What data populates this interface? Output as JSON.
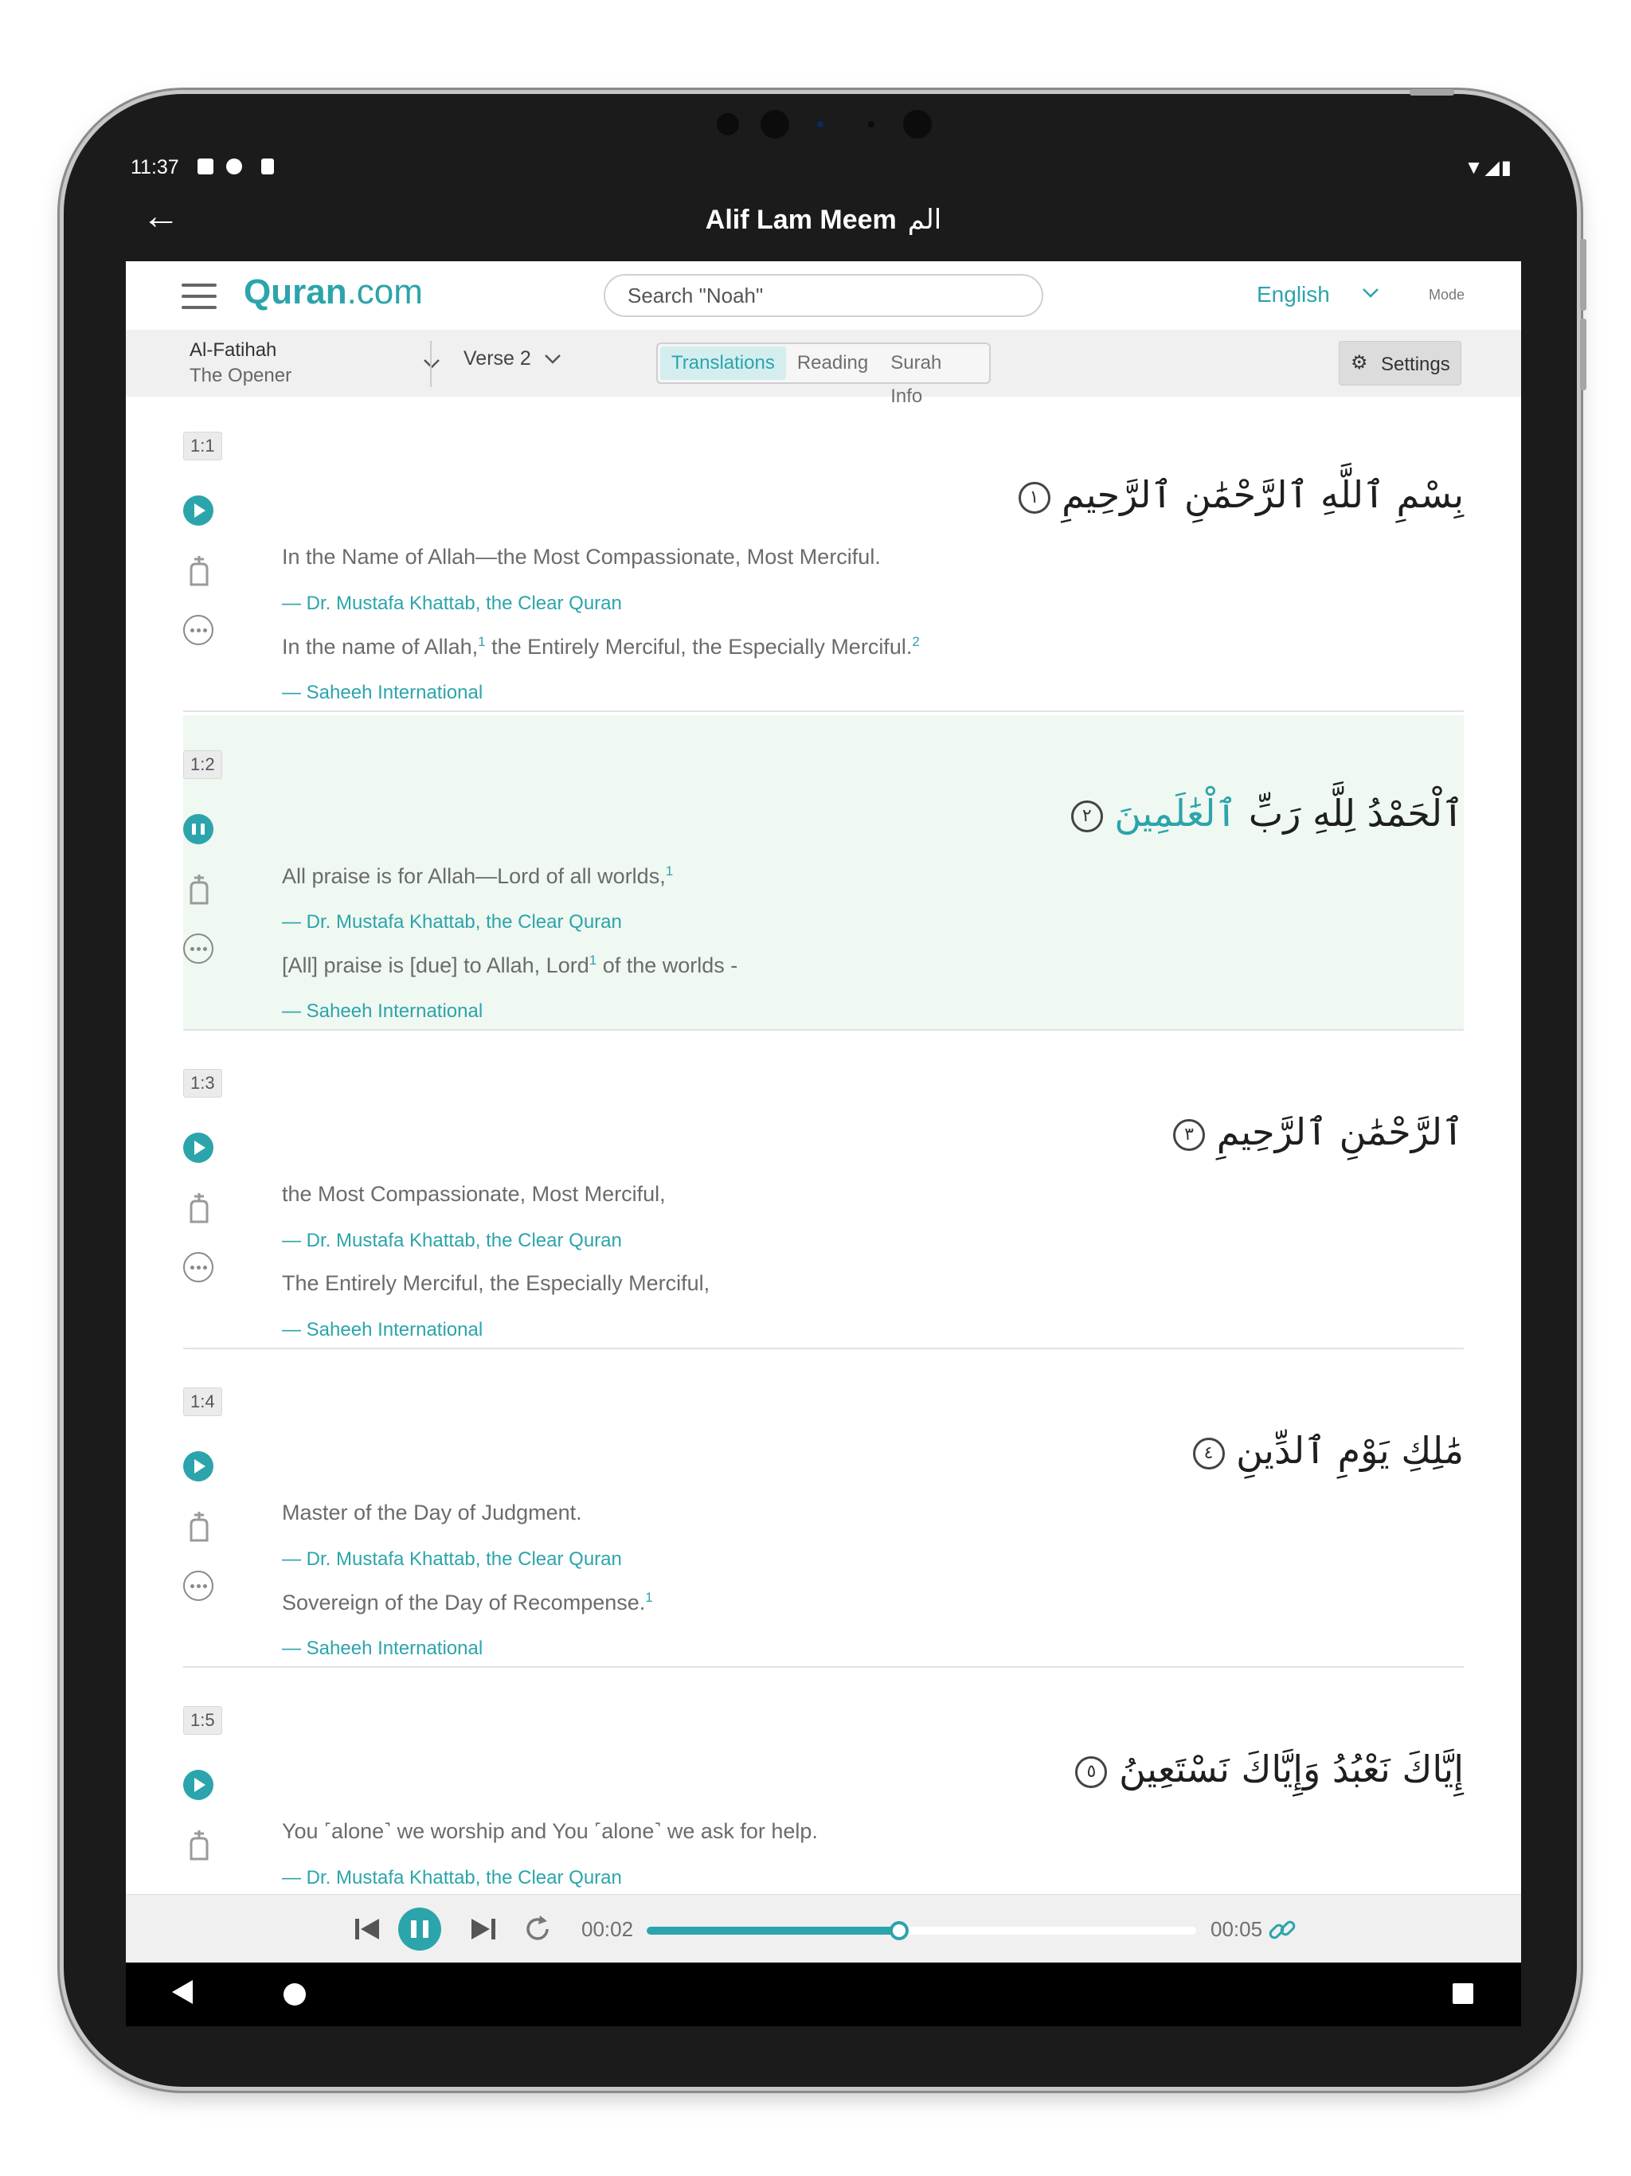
{
  "status_bar": {
    "time": "11:37",
    "left_icons": [
      "a-notification-icon",
      "circle-half-icon",
      "sd-card-icon"
    ],
    "right_icons": [
      "wifi-icon",
      "signal-icon",
      "battery-icon"
    ]
  },
  "app_bar": {
    "title": "Alif Lam Meem",
    "title_arabic": "الم"
  },
  "nav": {
    "logo_bold": "Quran",
    "logo_rest": ".com",
    "search_placeholder": "Search \"Noah\"",
    "language": "English",
    "mode_label": "Mode"
  },
  "toolbar": {
    "surah_name": "Al-Fatihah",
    "surah_translation": "The Opener",
    "verse_label": "Verse 2",
    "tabs": [
      "Translations",
      "Reading",
      "Surah Info"
    ],
    "active_tab": "Translations",
    "settings_label": "Settings"
  },
  "verses": [
    {
      "key": "1:1",
      "arabic": "بِسْمِ ٱللَّهِ ٱلرَّحْمَٰنِ ٱلرَّحِيمِ",
      "arabic_highlight": "",
      "end_marker": "١",
      "playing": false,
      "translations": [
        {
          "text": "In the Name of Allah—the Most Compassionate, Most Merciful.",
          "source": "— Dr. Mustafa Khattab, the Clear Quran"
        },
        {
          "text": "In the name of Allah,¹ the Entirely Merciful, the Especially Merciful.²",
          "source": "— Saheeh International"
        }
      ]
    },
    {
      "key": "1:2",
      "arabic": "ٱلْحَمْدُ لِلَّهِ رَبِّ",
      "arabic_highlight": "ٱلْعَٰلَمِينَ",
      "end_marker": "٢",
      "playing": true,
      "translations": [
        {
          "text": "All praise is for Allah—Lord of all worlds,¹",
          "source": "— Dr. Mustafa Khattab, the Clear Quran"
        },
        {
          "text": "[All] praise is [due] to Allah, Lord¹ of the worlds -",
          "source": "— Saheeh International"
        }
      ]
    },
    {
      "key": "1:3",
      "arabic": "ٱلرَّحْمَٰنِ ٱلرَّحِيمِ",
      "arabic_highlight": "",
      "end_marker": "٣",
      "playing": false,
      "translations": [
        {
          "text": "the Most Compassionate, Most Merciful,",
          "source": "— Dr. Mustafa Khattab, the Clear Quran"
        },
        {
          "text": "The Entirely Merciful, the Especially Merciful,",
          "source": "— Saheeh International"
        }
      ]
    },
    {
      "key": "1:4",
      "arabic": "مَٰلِكِ يَوْمِ ٱلدِّينِ",
      "arabic_highlight": "",
      "end_marker": "٤",
      "playing": false,
      "translations": [
        {
          "text": "Master of the Day of Judgment.",
          "source": "— Dr. Mustafa Khattab, the Clear Quran"
        },
        {
          "text": "Sovereign of the Day of Recompense.¹",
          "source": "— Saheeh International"
        }
      ]
    },
    {
      "key": "1:5",
      "arabic": "إِيَّاكَ نَعْبُدُ وَإِيَّاكَ نَسْتَعِينُ",
      "arabic_highlight": "",
      "end_marker": "٥",
      "playing": false,
      "translations": [
        {
          "text": "You ˹alone˺ we worship and You ˹alone˺ we ask for help.",
          "source": "— Dr. Mustafa Khattab, the Clear Quran"
        }
      ]
    }
  ],
  "player": {
    "current_time": "00:02",
    "total_time": "00:05",
    "progress": 0.46
  },
  "colors": {
    "accent": "#2ca4ab",
    "active_verse_bg": "#eff8f1",
    "toolbar_bg": "#f0f0f0",
    "app_bar_bg": "#1b1b1b"
  }
}
